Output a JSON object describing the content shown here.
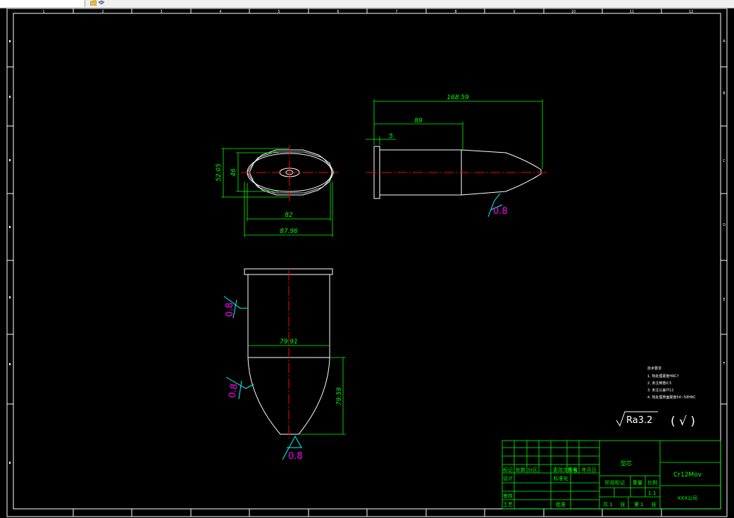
{
  "app": {
    "toolbar_icons": [
      "folder-icon",
      "layer-icon"
    ]
  },
  "colors": {
    "background": "#000000",
    "frame": "#ffffff",
    "part": "#ffffff",
    "dimension": "#00ff00",
    "centerline": "#ff0000",
    "roughness": "#00ffff",
    "roughness_value": "#ff00ff",
    "title_block": "#00ff00"
  },
  "grid_refs": {
    "columns": [
      "1",
      "2",
      "3",
      "4",
      "5",
      "6",
      "7",
      "8",
      "9",
      "10",
      "11",
      "12"
    ],
    "rows": [
      "A",
      "B",
      "C",
      "D",
      "E",
      "F"
    ]
  },
  "dimensions": {
    "top_overall": "168.59",
    "top_mid": "89",
    "top_flange": "5",
    "end_height_outer": "52.05",
    "end_height_inner": "46",
    "end_width_inner": "82",
    "end_width_outer": "87.96",
    "front_width": "79.91",
    "front_height": "79.59"
  },
  "roughness_marks": {
    "top_view": "0.8",
    "front_upper": "0.8",
    "front_lower": "0.8",
    "front_tip": "0.8"
  },
  "notes": {
    "heading": "技术要求",
    "items": [
      "1. 热处理硬度HRC?",
      "2. 未注倒角0.5",
      "3. 未注公差IT12",
      "4. 热处理表面硬度54~58HRC"
    ]
  },
  "surface_finish": {
    "general": "Ra3.2",
    "others": "( √ )"
  },
  "title_block": {
    "part_label": "型芯",
    "material": "Cr12Mov",
    "company": "XXX公司",
    "row_headers": [
      "标记",
      "处数",
      "分区",
      "更改文件号",
      "签名",
      "年月日"
    ],
    "designer": "设计",
    "standardize": "标准化",
    "reviewer": "审核",
    "process": "工艺",
    "approve": "批准",
    "stage_mark": "阶段标记",
    "weight": "重量",
    "scale_label": "比例",
    "scale_value": "1:1",
    "sheets_total_prefix": "共 1",
    "sheets_unit": "张",
    "sheet_no_prefix": "第 1",
    "sheet_unit": "张"
  }
}
